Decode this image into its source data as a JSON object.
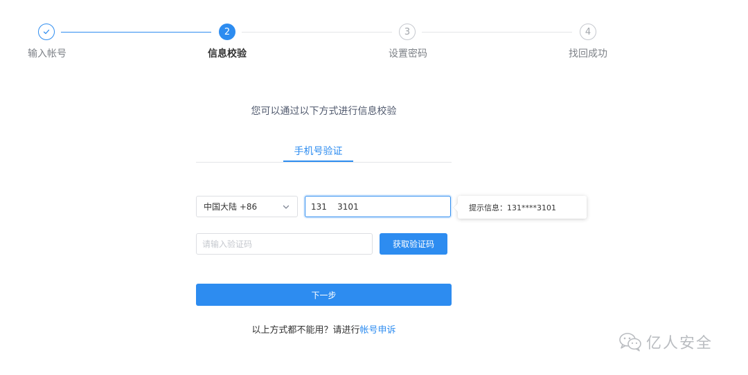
{
  "steps": [
    {
      "label": "输入帐号",
      "state": "finished"
    },
    {
      "label": "信息校验",
      "number": "2",
      "state": "active"
    },
    {
      "label": "设置密码",
      "number": "3",
      "state": "wait"
    },
    {
      "label": "找回成功",
      "number": "4",
      "state": "wait"
    }
  ],
  "subtitle": "您可以通过以下方式进行信息校验",
  "tab": {
    "label": "手机号验证"
  },
  "region_select": {
    "value": "中国大陆 +86"
  },
  "phone_input": {
    "value": "131    3101"
  },
  "tooltip": {
    "text": "提示信息：131****3101"
  },
  "code_input": {
    "placeholder": "请输入验证码"
  },
  "get_code_button": {
    "label": "获取验证码"
  },
  "next_button": {
    "label": "下一步"
  },
  "footer": {
    "text": "以上方式都不能用？请进行",
    "link": "帐号申诉"
  },
  "watermark": {
    "text": "亿人安全"
  },
  "colors": {
    "primary": "#2d8cf0",
    "border": "#dcdee2",
    "text": "#333333",
    "muted": "#7d8187"
  }
}
